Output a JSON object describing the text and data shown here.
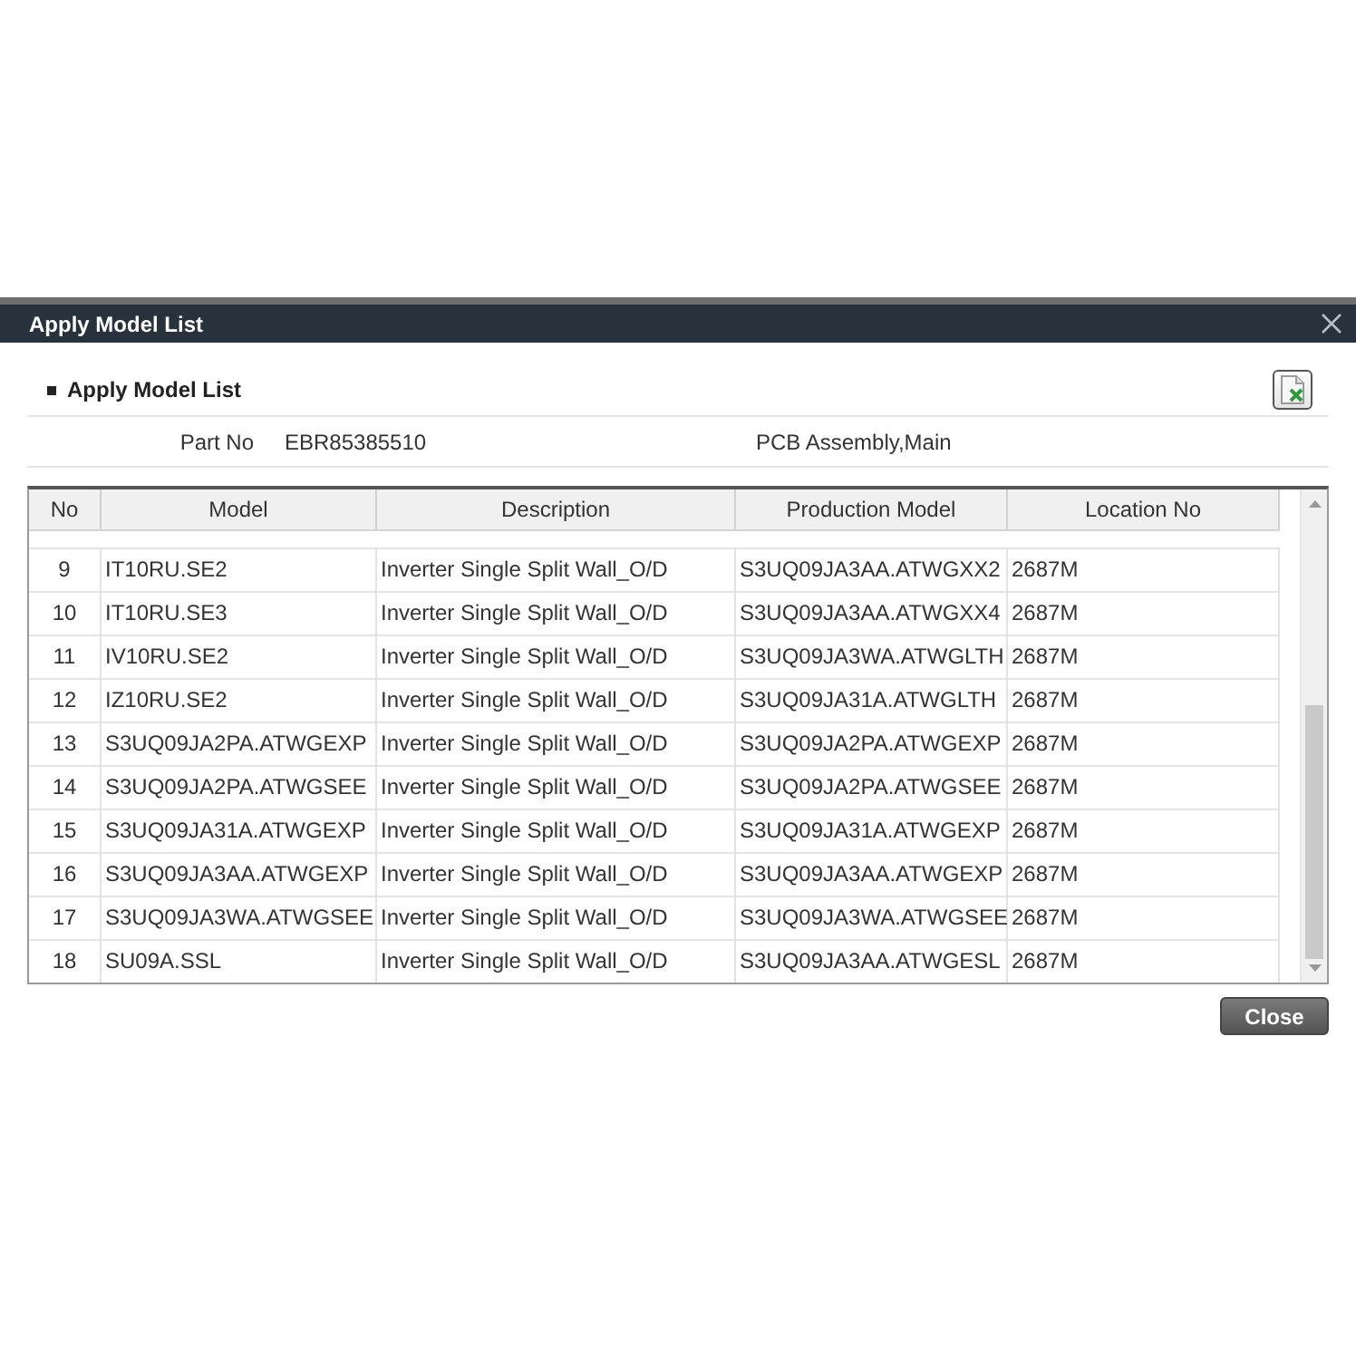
{
  "dialog": {
    "title": "Apply Model List"
  },
  "section": {
    "title": "Apply Model List"
  },
  "part_info": {
    "label": "Part No",
    "value": "EBR85385510",
    "description": "PCB Assembly,Main"
  },
  "table": {
    "columns": [
      "No",
      "Model",
      "Description",
      "Production Model",
      "Location No"
    ],
    "rows": [
      [
        "9",
        "IT10RU.SE2",
        "Inverter Single Split Wall_O/D",
        "S3UQ09JA3AA.ATWGXX2",
        "2687M"
      ],
      [
        "10",
        "IT10RU.SE3",
        "Inverter Single Split Wall_O/D",
        "S3UQ09JA3AA.ATWGXX4",
        "2687M"
      ],
      [
        "11",
        "IV10RU.SE2",
        "Inverter Single Split Wall_O/D",
        "S3UQ09JA3WA.ATWGLTH",
        "2687M"
      ],
      [
        "12",
        "IZ10RU.SE2",
        "Inverter Single Split Wall_O/D",
        "S3UQ09JA31A.ATWGLTH",
        "2687M"
      ],
      [
        "13",
        "S3UQ09JA2PA.ATWGEXP",
        "Inverter Single Split Wall_O/D",
        "S3UQ09JA2PA.ATWGEXP",
        "2687M"
      ],
      [
        "14",
        "S3UQ09JA2PA.ATWGSEE",
        "Inverter Single Split Wall_O/D",
        "S3UQ09JA2PA.ATWGSEE",
        "2687M"
      ],
      [
        "15",
        "S3UQ09JA31A.ATWGEXP",
        "Inverter Single Split Wall_O/D",
        "S3UQ09JA31A.ATWGEXP",
        "2687M"
      ],
      [
        "16",
        "S3UQ09JA3AA.ATWGEXP",
        "Inverter Single Split Wall_O/D",
        "S3UQ09JA3AA.ATWGEXP",
        "2687M"
      ],
      [
        "17",
        "S3UQ09JA3WA.ATWGSEE",
        "Inverter Single Split Wall_O/D",
        "S3UQ09JA3WA.ATWGSEE",
        "2687M"
      ],
      [
        "18",
        "SU09A.SSL",
        "Inverter Single Split Wall_O/D",
        "S3UQ09JA3AA.ATWGESL",
        "2687M"
      ]
    ]
  },
  "buttons": [
    {
      "label": "Close"
    }
  ]
}
